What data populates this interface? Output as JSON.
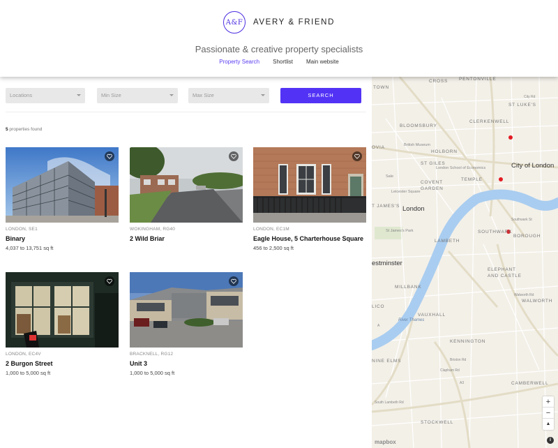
{
  "brand": {
    "mark": "A&F",
    "name": "AVERY & FRIEND",
    "tagline": "Passionate & creative property specialists"
  },
  "nav": [
    {
      "label": "Property Search",
      "active": true
    },
    {
      "label": "Shortlist",
      "active": false
    },
    {
      "label": "Main website",
      "active": false
    }
  ],
  "filters": {
    "locations": "Locations",
    "min_size": "Min Size",
    "max_size": "Max Size",
    "search": "SEARCH"
  },
  "results": {
    "count": "5",
    "suffix": " properties found"
  },
  "properties": [
    {
      "location": "LONDON, SE1",
      "name": "Binary",
      "size": "4,037 to 13,751 sq ft"
    },
    {
      "location": "WOKINGHAM, RG40",
      "name": "2 Wild Briar",
      "size": ""
    },
    {
      "location": "LONDON, EC1M",
      "name": "Eagle House, 5 Charterhouse Square",
      "size": "456 to 2,500 sq ft"
    },
    {
      "location": "LONDON, EC4V",
      "name": "2 Burgon Street",
      "size": "1,000 to 5,000 sq ft"
    },
    {
      "location": "BRACKNELL, RG12",
      "name": "Unit 3",
      "size": "1,000 to 5,000 sq ft"
    }
  ],
  "map": {
    "labels": {
      "town": "TOWN",
      "cross": "CROSS",
      "pentonville": "PENTONVILLE",
      "city_rd": "City Rd",
      "st_lukes": "ST LUKE'S",
      "bloomsbury": "BLOOMSBURY",
      "clerkenwell": "CLERKENWELL",
      "via": "OVIA",
      "holborn": "HOLBORN",
      "british_museum": "British Museum",
      "st_giles": "ST GILES",
      "lse": "London School of Economics",
      "city_of_london": "City of London",
      "covent": "COVENT",
      "garden": "GARDEN",
      "temple": "TEMPLE",
      "leicester": "Leicester Square",
      "james": "T JAMES'S",
      "london": "London",
      "southwark_st": "Southwark St",
      "st_james_park": "St James's Park",
      "southwark": "SOUTHWARK",
      "borough": "BOROUGH",
      "lambeth": "LAMBETH",
      "westminster": "estminster",
      "elephant": "ELEPHANT",
      "castle": "AND CASTLE",
      "millbank": "MILLBANK",
      "walworth": "WALWORTH",
      "lico": "LICO",
      "vauxhall": "VAUXHALL",
      "river": "River Thames",
      "kennington": "KENNINGTON",
      "nine_elms": "NINE ELMS",
      "camberwell": "CAMBERWELL",
      "stockwell": "STOCKWELL",
      "sale": "Sale",
      "clapham_rd": "Clapham Rd",
      "brixton_rd": "Brixton Rd",
      "walworth_rd": "Walworth Rd",
      "old_kent": "Old Kent Rd",
      "south_lambeth": "South Lambeth Rd",
      "a": "A",
      "a3": "A3"
    },
    "zoom_in": "+",
    "zoom_out": "−",
    "compass": "▲",
    "attribution": "mapbox",
    "info": "i"
  },
  "colors": {
    "accent": "#5233f5",
    "map_water": "#a9cdf0",
    "marker": "#e31b23"
  }
}
